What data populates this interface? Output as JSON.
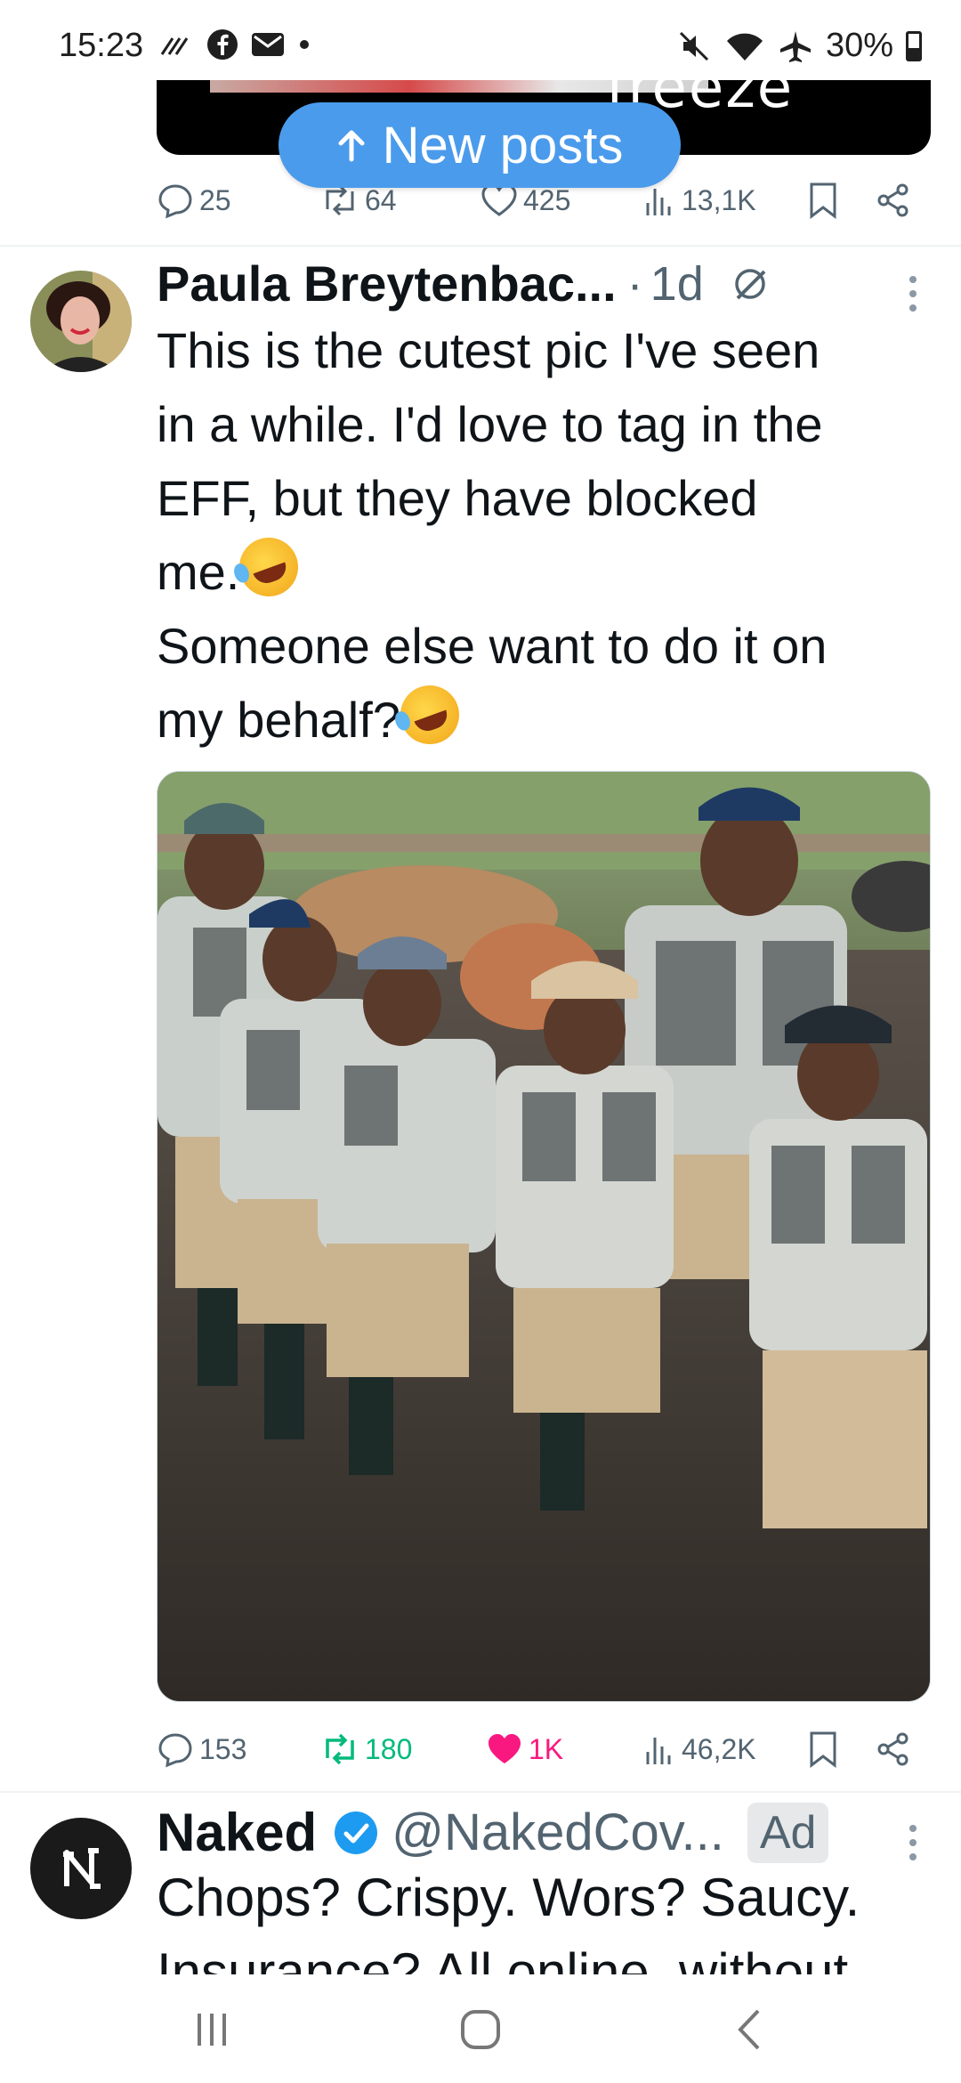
{
  "status_bar": {
    "time": "15:23",
    "battery": "30%"
  },
  "top_tweet": {
    "media_text": "freeze",
    "replies": "25",
    "reposts": "64",
    "likes": "425",
    "views": "13,1K"
  },
  "new_posts_label": "New posts",
  "tweet": {
    "author": "Paula Breytenbac...",
    "time": "1d",
    "text_lines": [
      "This is the cutest pic I've seen",
      "in a while. I'd love to tag in the",
      "EFF, but they have blocked",
      "me.",
      "Someone else want to do it on",
      "my behalf?"
    ],
    "replies": "153",
    "reposts": "180",
    "likes": "1K",
    "views": "46,2K"
  },
  "ad_tweet": {
    "author": "Naked",
    "handle": "@NakedCov...",
    "badge": "Ad",
    "text_line1": "Chops? Crispy. Wors? Saucy.",
    "text_line2": "Insurance? All online, without"
  },
  "colors": {
    "accent": "#4a9bec",
    "like_active": "#f91880",
    "repost_active": "#00ba7c",
    "secondary_text": "#536471"
  }
}
